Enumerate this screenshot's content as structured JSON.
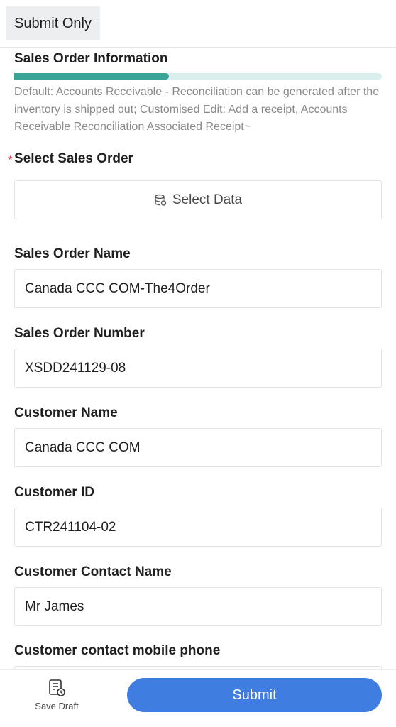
{
  "toolbar": {
    "submit_only_label": "Submit Only"
  },
  "section": {
    "title": "Sales Order Information",
    "progress_fraction": 0.42,
    "description": "Default: Accounts Receivable - Reconciliation can be generated after the inventory is shipped out; Customised Edit: Add a receipt, Accounts Receivable Reconciliation Associated Receipt~"
  },
  "form": {
    "select_sales_order": {
      "required_mark": "*",
      "label": "Select Sales Order",
      "button_label": "Select Data",
      "icon": "database-icon"
    },
    "sales_order_name": {
      "label": "Sales Order Name",
      "value": "Canada CCC COM-The4Order"
    },
    "sales_order_number": {
      "label": "Sales Order Number",
      "value": "XSDD241129-08"
    },
    "customer_name": {
      "label": "Customer Name",
      "value": "Canada CCC COM"
    },
    "customer_id": {
      "label": "Customer ID",
      "value": "CTR241104-02"
    },
    "customer_contact_name": {
      "label": "Customer Contact Name",
      "value": "Mr James"
    },
    "customer_contact_mobile": {
      "label": "Customer contact mobile phone",
      "value": ""
    }
  },
  "bottom_bar": {
    "save_draft_label": "Save Draft",
    "save_draft_icon": "draft-icon",
    "submit_label": "Submit"
  },
  "colors": {
    "accent": "#3f7de0",
    "progress": "#3aa596",
    "progress_track": "#daeeed",
    "required": "#d9363e"
  }
}
